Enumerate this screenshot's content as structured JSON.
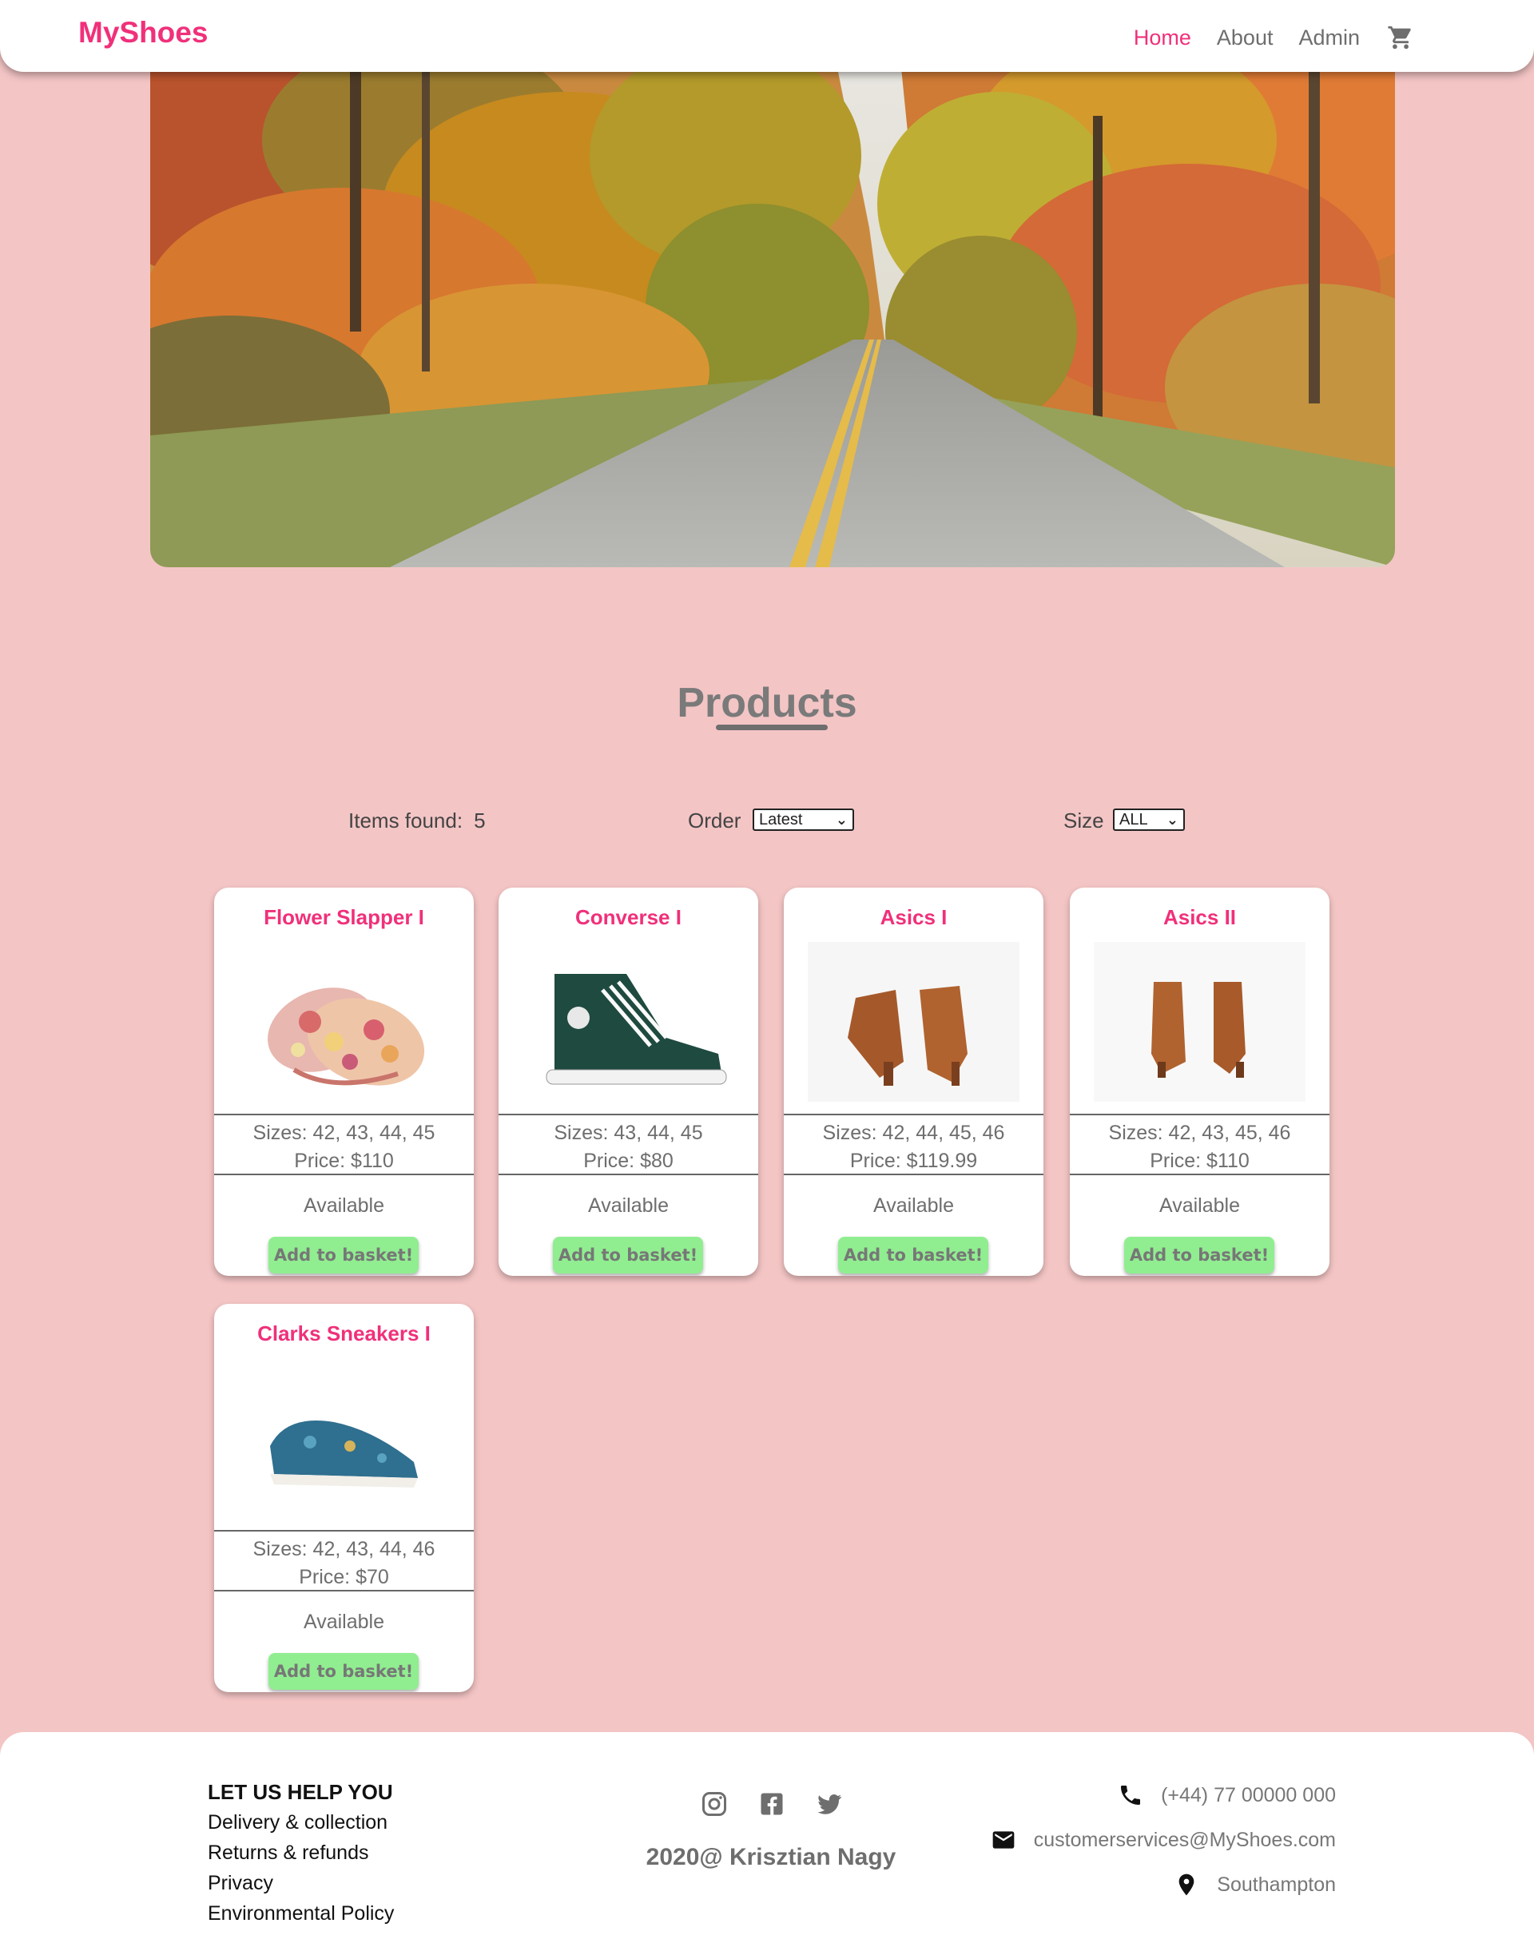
{
  "header": {
    "brand": "MyShoes",
    "nav": {
      "home": "Home",
      "about": "About",
      "admin": "Admin"
    },
    "cart_icon": "cart-icon",
    "brand_color": "#f0307a"
  },
  "hero": {
    "image": "autumn-forest-road"
  },
  "products": {
    "title": "Products",
    "items_found_label": "Items found:",
    "items_found_count": "5",
    "order_label": "Order",
    "order_value": "Latest",
    "size_label": "Size",
    "size_value": "ALL"
  },
  "cards": [
    {
      "name": "Flower Slapper I",
      "sizes": "Sizes: 42, 43, 44, 45",
      "price": "Price: $110",
      "status": "Available",
      "button": "Add to basket!"
    },
    {
      "name": "Converse I",
      "sizes": "Sizes: 43, 44, 45",
      "price": "Price: $80",
      "status": "Available",
      "button": "Add to basket!"
    },
    {
      "name": "Asics I",
      "sizes": "Sizes: 42, 44, 45, 46",
      "price": "Price: $119.99",
      "status": "Available",
      "button": "Add to basket!"
    },
    {
      "name": "Asics II",
      "sizes": "Sizes: 42, 43, 45, 46",
      "price": "Price: $110",
      "status": "Available",
      "button": "Add to basket!"
    },
    {
      "name": "Clarks Sneakers I",
      "sizes": "Sizes: 42, 43, 44, 46",
      "price": "Price: $70",
      "status": "Available",
      "button": "Add to basket!"
    }
  ],
  "footer": {
    "help_title": "LET US HELP YOU",
    "links": [
      "Delivery & collection",
      "Returns & refunds",
      "Privacy",
      "Environmental Policy"
    ],
    "social_icons": [
      "instagram-icon",
      "facebook-icon",
      "twitter-icon"
    ],
    "copyright": "2020@ Krisztian Nagy",
    "phone": "(+44) 77 00000 000",
    "email": "customerservices@MyShoes.com",
    "location": "Southampton"
  },
  "colors": {
    "background": "#f4c5c5",
    "accent": "#f0307a",
    "button": "#90ee90"
  }
}
